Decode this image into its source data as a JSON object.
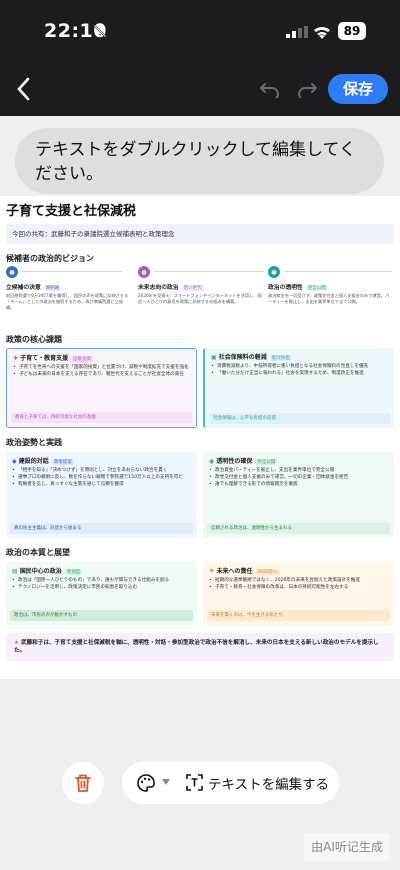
{
  "status": {
    "time": "22:10",
    "battery": "89"
  },
  "nav": {
    "save": "保存"
  },
  "bubble": {
    "text": "テキストをダブルクリックして編集してください。"
  },
  "doc": {
    "title": "子育て支援と社保減税",
    "share": "今回の共有：武藤和子の衆議院選立候補表明と政策理念",
    "sections": {
      "vision": "候補者の政治的ビジョン",
      "core": "政策の核心課題",
      "stance": "政治姿勢と実践",
      "essence": "政治の本質と展望"
    },
    "vision": [
      {
        "title": "立候補の決意",
        "tag": "真剣味",
        "desc": "前回参院選で9万3957票を獲得し、国民の声を政策に反映させる「チーム」としての政治を継続するため、再び衆議院選に立候補。",
        "color": "#2f6fd8"
      },
      {
        "title": "未来志向の政治",
        "tag": "若い世代",
        "desc": "2026年を見据え、スマートフォンやインターネットを活用し、国民一人ひとりの意見を政策に反映する仕組みを構築。",
        "color": "#a45be0"
      },
      {
        "title": "政治の透明性",
        "tag": "完全公開",
        "desc": "政治献金を一切受けず、政策交付金と個人支援金のみで運営。パーティーを廃止し、支出を業界単位で全て公開。",
        "color": "#19a79a"
      }
    ],
    "cards": [
      {
        "title": "子育て・教育支援",
        "tag": "国家投資",
        "b1": "子育てを世帯への支援を「国家的投資」と位置づけ、減税や制度拡充で支援を強化",
        "b2": "子どもは未来の日本を支える存在であり、親世代を支えることが社会全体の責任",
        "foot": "教育と子育ては、持続可能な社会の基盤"
      },
      {
        "title": "社会保険料の軽減",
        "tag": "家計負担",
        "b1": "消費税減税より、中低所得者に重い負担となる社会保険料の見直しを優先",
        "b2": "「働いた分だけ正当に報われる」社会を実現するため、制度改正を推進",
        "foot": "社会保険は、公平な負担の前提"
      },
      {
        "title": "建設的対話",
        "tag": "政策提案",
        "b1": "「相手を知る」「決めつけず」を原則とし、対立をあおらない政治を貫く",
        "b2": "選挙プロの戦術に反し、数を作らない戦略で参院選で150万人以上の支持を得た",
        "b3": "有権者を信じ、真っすぐな主張を通じて信頼を獲得",
        "foot": "真の民主主義は、対話から始まる"
      },
      {
        "title": "透明性の確保",
        "tag": "完全公開",
        "b1": "政治資金パーティーを廃止し、支出を業界単位で完全公開",
        "b2": "政党交付金と個人支援のみで運営、一切の企業・団体献金を拒否",
        "b3": "誰でも理解できる形での情報開示を徹底",
        "foot": "信頼される政治は、透明性から生まれる"
      },
      {
        "title": "国民中心の政治",
        "tag": "参加型",
        "b1": "政治は「国民一人ひとりのもの」であり、誰もが関与できる仕組みを創る",
        "b2": "テクノロジーを活用し、政策決定に市民の知恵を取り込む",
        "foot": "政治は、市民の声が動かすもの"
      },
      {
        "title": "未来への責任",
        "tag": "2026年へ",
        "b1": "短期的な選挙戦術ではなく、2026年の未来を見据えた政策設計を推進",
        "b2": "子育て・教育・社会保障の改革は、日本の持続可能性を左右する",
        "foot": "未来を築くのは、今を生きる私たち"
      }
    ],
    "summary": "武藤和子は、子育て支援と社保減税を軸に、透明性・対話・参加型政治で政治不信を解消し、未来の日本を支える新しい政治のモデルを提示した。"
  },
  "bottom": {
    "edit": "テキストを編集する",
    "ai": "由AI听记生成"
  }
}
